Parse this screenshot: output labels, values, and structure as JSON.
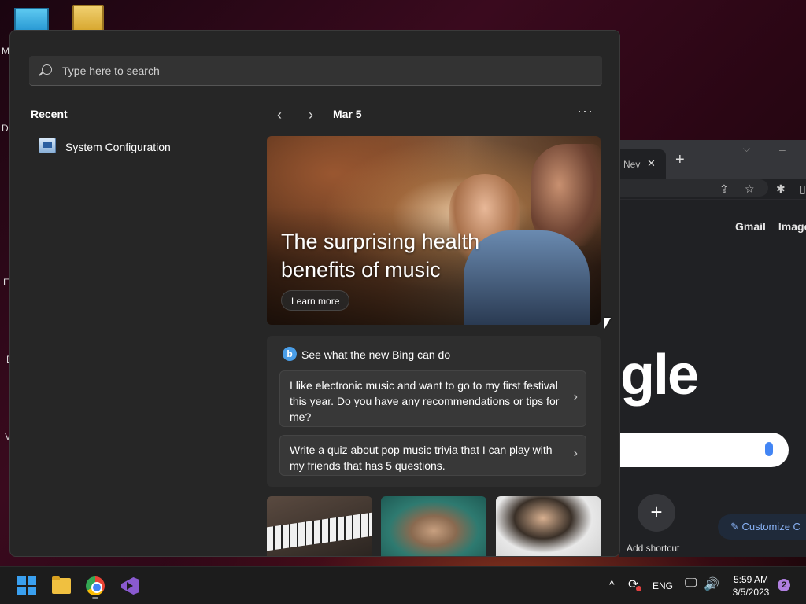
{
  "desktop": {
    "side_labels": [
      "M",
      "Da",
      "I",
      "Er",
      "E",
      "V"
    ]
  },
  "browser": {
    "tab_label": "Nev",
    "tab_close": "✕",
    "new_tab": "+",
    "tab_menu": "⌵",
    "minimize": "–",
    "links": [
      "Gmail",
      "Images"
    ],
    "logo_text": "gle",
    "add_shortcut_label": "Add shortcut",
    "customize_label": "Customize C"
  },
  "start": {
    "search": {
      "placeholder": "Type here to search",
      "value": ""
    },
    "recent": {
      "title": "Recent",
      "items": [
        {
          "label": "System Configuration",
          "icon": "system-config-icon"
        }
      ]
    },
    "feed": {
      "prev": "‹",
      "next": "›",
      "date": "Mar 5",
      "more": "···",
      "hero": {
        "title": "The surprising health benefits of music",
        "button": "Learn more"
      },
      "bing": {
        "logo": "b",
        "title": "See what the new Bing can do",
        "prompts": [
          "I like electronic music and want to go to my first festival this year. Do you have any recommendations or tips for me?",
          "Write a quiz about pop music trivia that I can play with my friends that has 5 questions."
        ],
        "chevron": "›"
      }
    }
  },
  "taskbar": {
    "apps": [
      "start-icon",
      "file-explorer-icon",
      "chrome-icon",
      "visual-studio-icon"
    ],
    "tray": {
      "chevron": "^",
      "sync": "⟳",
      "language": "ENG",
      "network": "🖵",
      "volume": "🔊",
      "time": "5:59 AM",
      "date": "3/5/2023",
      "notification_count": "2"
    }
  }
}
